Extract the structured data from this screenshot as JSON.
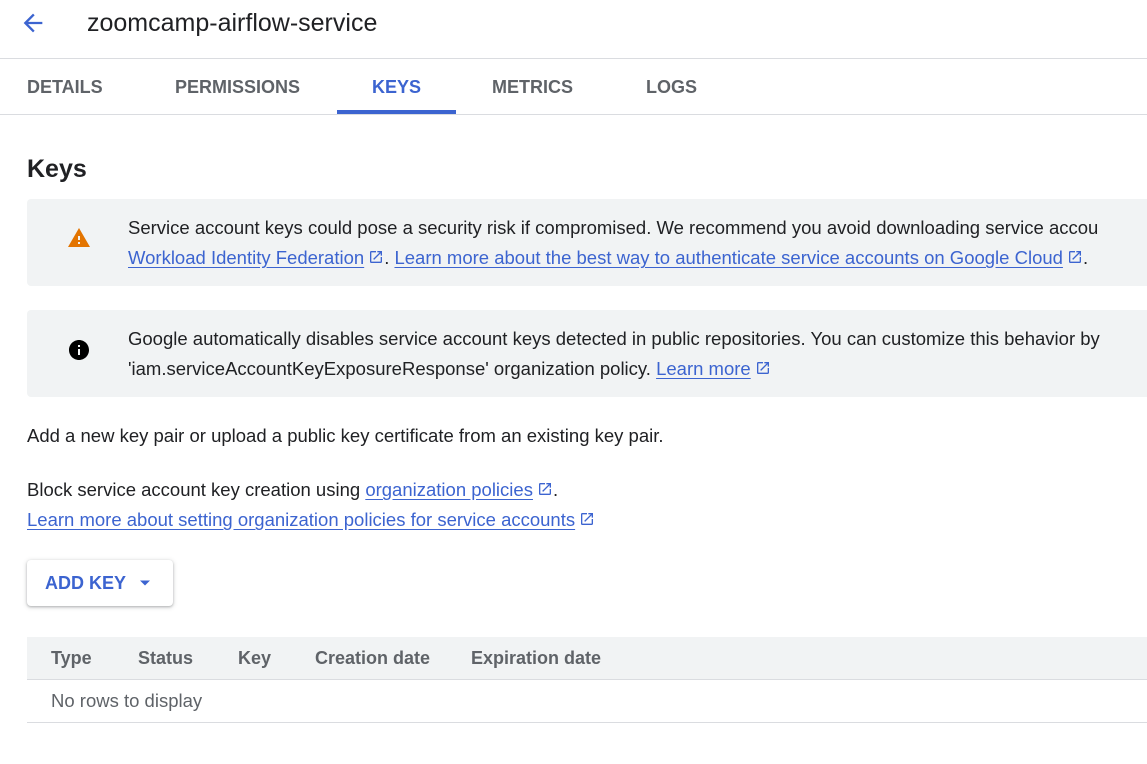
{
  "header": {
    "title": "zoomcamp-airflow-service",
    "back_icon": "arrow-back-icon"
  },
  "tabs": [
    {
      "label": "DETAILS",
      "active": false
    },
    {
      "label": "PERMISSIONS",
      "active": false
    },
    {
      "label": "KEYS",
      "active": true
    },
    {
      "label": "METRICS",
      "active": false
    },
    {
      "label": "LOGS",
      "active": false
    }
  ],
  "section": {
    "title": "Keys"
  },
  "warning_banner": {
    "icon": "warning-icon",
    "line1": "Service account keys could pose a security risk if compromised. We recommend you avoid downloading service accou",
    "link1": "Workload Identity Federation",
    "sep": ".",
    "link2": "Learn more about the best way to authenticate service accounts on Google Cloud",
    "end": "."
  },
  "info_banner": {
    "icon": "info-icon",
    "line1": "Google automatically disables service account keys detected in public repositories. You can customize this behavior by",
    "line2": "'iam.serviceAccountKeyExposureResponse' organization policy.",
    "link": "Learn more"
  },
  "intro_text": "Add a new key pair or upload a public key certificate from an existing key pair.",
  "block_text": {
    "prefix": "Block service account key creation using",
    "link": "organization policies",
    "suffix": ".",
    "link2": "Learn more about setting organization policies for service accounts"
  },
  "add_key_button": {
    "label": "ADD KEY",
    "icon": "arrow-drop-down-icon"
  },
  "table": {
    "columns": [
      "Type",
      "Status",
      "Key",
      "Creation date",
      "Expiration date"
    ],
    "empty_message": "No rows to display"
  },
  "colors": {
    "accent": "#3c64d0",
    "warning": "#e37400",
    "banner_bg": "#f1f3f4"
  }
}
